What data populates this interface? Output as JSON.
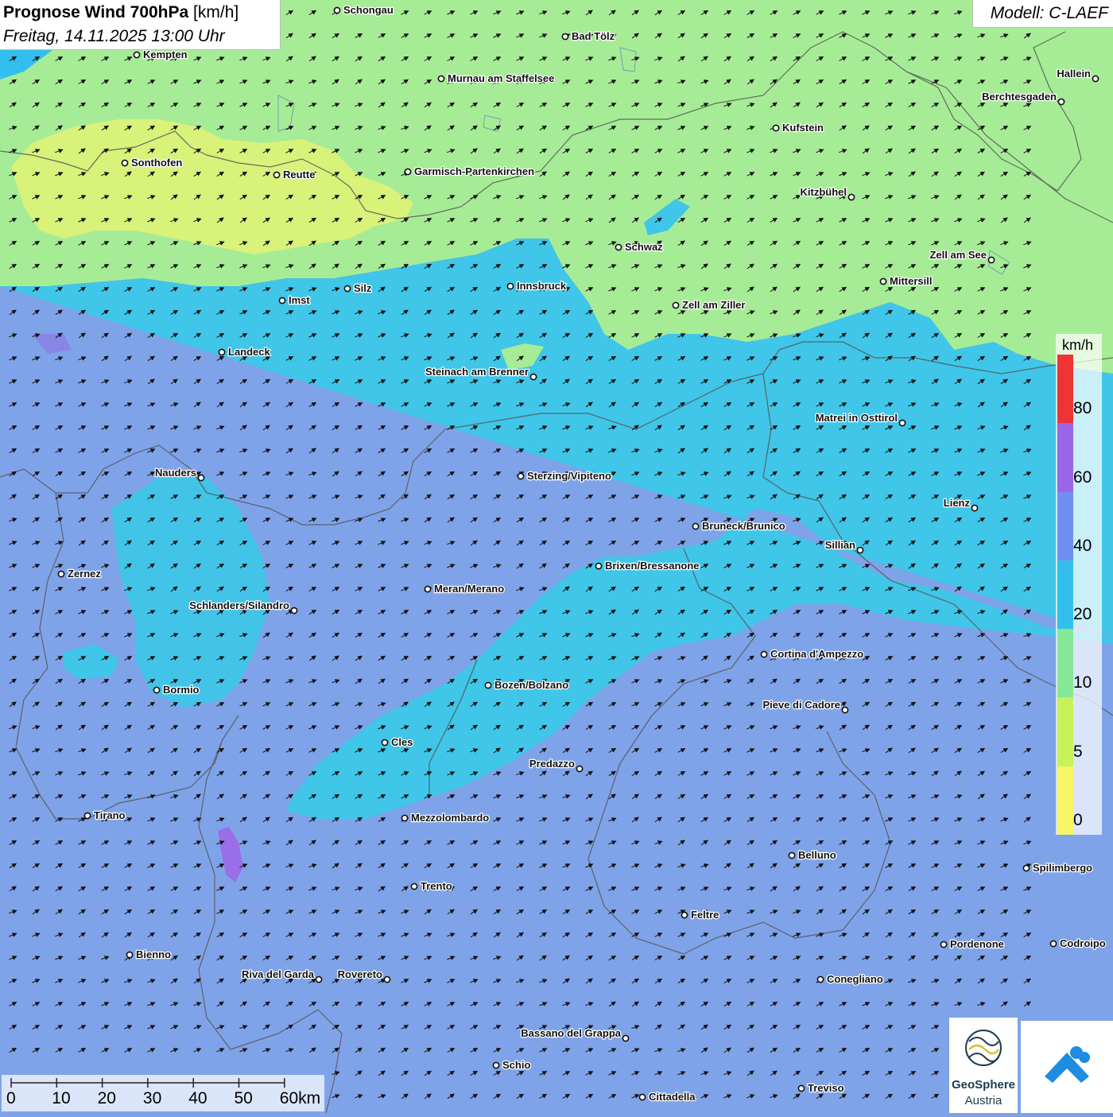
{
  "title": {
    "main": "Prognose Wind 700hPa",
    "unit": "[km/h]",
    "datetime": "Freitag, 14.11.2025 13:00 Uhr"
  },
  "model": "Modell: C-LAEF",
  "legend": {
    "unit": "km/h",
    "labels": [
      "80",
      "60",
      "40",
      "20",
      "10",
      "5",
      "0"
    ],
    "segments": [
      {
        "value": "80+",
        "color": "#ee3434"
      },
      {
        "value": "60-80",
        "color": "#9a66e8"
      },
      {
        "value": "40-60",
        "color": "#6f8ff0"
      },
      {
        "value": "20-40",
        "color": "#33bfee"
      },
      {
        "value": "10-20",
        "color": "#84e896"
      },
      {
        "value": "5-10",
        "color": "#c8f25a"
      },
      {
        "value": "0-5",
        "color": "#f5f566"
      }
    ]
  },
  "scale_bar": {
    "labels": [
      "0",
      "10",
      "20",
      "30",
      "40",
      "50",
      "60km"
    ]
  },
  "logos": {
    "geosphere_line1": "GeoSphere",
    "geosphere_line2": "Austria",
    "secondary_icon": "cloud-mountain-icon"
  },
  "map": {
    "wind_direction": "west-south-west to east-north-east",
    "colors": {
      "calm_yellow": "#d8f27a",
      "light_green": "#a6ec96",
      "medium_cyan": "#3fc6e8",
      "strong_blue": "#7fa3e8",
      "very_strong_purple": "#9a6ee8"
    },
    "places": [
      {
        "name": "Schongau",
        "label_side": "right"
      },
      {
        "name": "Bad Tölz",
        "label_side": "right"
      },
      {
        "name": "Kempten",
        "label_side": "right"
      },
      {
        "name": "Murnau am Staffelsee",
        "label_side": "right"
      },
      {
        "name": "Hallein",
        "label_side": "left"
      },
      {
        "name": "Berchtesgaden",
        "label_side": "left"
      },
      {
        "name": "Kufstein",
        "label_side": "right"
      },
      {
        "name": "Sonthofen",
        "label_side": "right"
      },
      {
        "name": "Reutte",
        "label_side": "right"
      },
      {
        "name": "Garmisch-Partenkirchen",
        "label_side": "right"
      },
      {
        "name": "Kitzbühel",
        "label_side": "left"
      },
      {
        "name": "Schwaz",
        "label_side": "right"
      },
      {
        "name": "Zell am See",
        "label_side": "left"
      },
      {
        "name": "Mittersill",
        "label_side": "right"
      },
      {
        "name": "Innsbruck",
        "label_side": "right"
      },
      {
        "name": "Silz",
        "label_side": "right"
      },
      {
        "name": "Imst",
        "label_side": "right"
      },
      {
        "name": "Zell am Ziller",
        "label_side": "right"
      },
      {
        "name": "Landeck",
        "label_side": "right"
      },
      {
        "name": "Steinach am Brenner",
        "label_side": "left"
      },
      {
        "name": "Matrei in Osttirol",
        "label_side": "left"
      },
      {
        "name": "Nauders",
        "label_side": "left"
      },
      {
        "name": "Sterzing/Vipiteno",
        "label_side": "right"
      },
      {
        "name": "Lienz",
        "label_side": "left"
      },
      {
        "name": "Bruneck/Brunico",
        "label_side": "right"
      },
      {
        "name": "Sillian",
        "label_side": "left"
      },
      {
        "name": "Brixen/Bressanone",
        "label_side": "right"
      },
      {
        "name": "Zernez",
        "label_side": "right"
      },
      {
        "name": "Meran/Merano",
        "label_side": "right"
      },
      {
        "name": "Schlanders/Silandro",
        "label_side": "left"
      },
      {
        "name": "Cortina d'Ampezzo",
        "label_side": "right"
      },
      {
        "name": "Bozen/Bolzano",
        "label_side": "right"
      },
      {
        "name": "Bormio",
        "label_side": "right"
      },
      {
        "name": "Pieve di Cadore",
        "label_side": "left"
      },
      {
        "name": "Cles",
        "label_side": "right"
      },
      {
        "name": "Predazzo",
        "label_side": "left"
      },
      {
        "name": "Tirano",
        "label_side": "right"
      },
      {
        "name": "Mezzolombardo",
        "label_side": "right"
      },
      {
        "name": "Belluno",
        "label_side": "right"
      },
      {
        "name": "Spilimbergo",
        "label_side": "right"
      },
      {
        "name": "Trento",
        "label_side": "right"
      },
      {
        "name": "Feltre",
        "label_side": "right"
      },
      {
        "name": "Pordenone",
        "label_side": "right"
      },
      {
        "name": "Codroipo",
        "label_side": "right"
      },
      {
        "name": "Bienno",
        "label_side": "right"
      },
      {
        "name": "Riva del Garda",
        "label_side": "left"
      },
      {
        "name": "Rovereto",
        "label_side": "left"
      },
      {
        "name": "Conegliano",
        "label_side": "right"
      },
      {
        "name": "Bassano del Grappa",
        "label_side": "left"
      },
      {
        "name": "Schio",
        "label_side": "right"
      },
      {
        "name": "Treviso",
        "label_side": "right"
      },
      {
        "name": "Cittadella",
        "label_side": "right"
      }
    ]
  }
}
